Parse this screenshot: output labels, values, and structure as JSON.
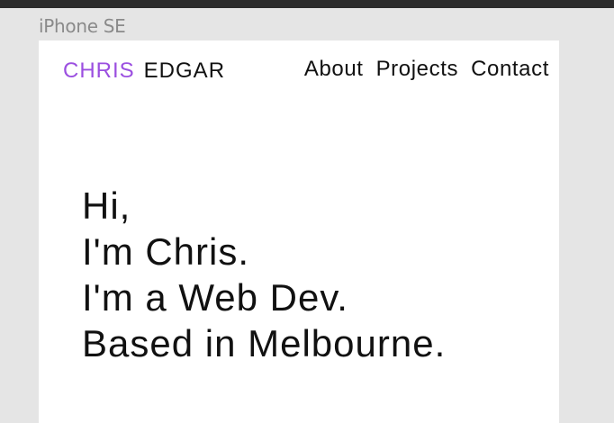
{
  "frame": {
    "label": "iPhone SE"
  },
  "header": {
    "logo_first": "CHRIS",
    "logo_last": "EDGAR",
    "nav": [
      "About",
      "Projects",
      "Contact"
    ]
  },
  "hero": {
    "lines": [
      "Hi,",
      "I'm Chris.",
      "I'm a Web Dev.",
      "Based in Melbourne."
    ]
  },
  "colors": {
    "accent": "#9b4fe0",
    "text": "#111111",
    "canvas": "#e5e5e5",
    "artboard": "#ffffff"
  }
}
